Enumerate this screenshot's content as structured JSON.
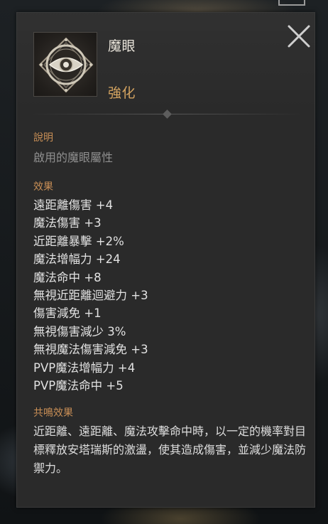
{
  "item": {
    "name": "魔眼",
    "grade": "強化",
    "icon": "eye-rune-icon"
  },
  "close_icon": "close-x-icon",
  "description": {
    "label": "說明",
    "text": "啟用的魔眼屬性"
  },
  "effects": {
    "label": "效果",
    "items": [
      "遠距離傷害 +4",
      "魔法傷害 +3",
      "近距離暴擊 +2%",
      "魔法增幅力 +24",
      "魔法命中 +8",
      "無視近距離迴避力 +3",
      "傷害減免 +1",
      "無視傷害減少 3%",
      "無視魔法傷害減免 +3",
      "PVP魔法增幅力 +4",
      "PVP魔法命中 +5"
    ]
  },
  "resonance": {
    "label": "共鳴效果",
    "text": "近距離、遠距離、魔法攻擊命中時，以一定的機率對目標釋放安塔瑞斯的激盪，使其造成傷害，並減少魔法防禦力。"
  },
  "colors": {
    "panel_bg": "#2a2a2a",
    "section_label": "#c98f56",
    "grade": "#d3a360",
    "body_text": "#e2e2e2",
    "muted_text": "#8f8f8f"
  }
}
